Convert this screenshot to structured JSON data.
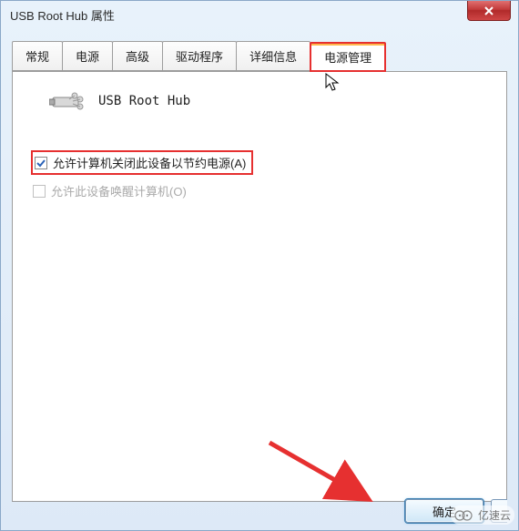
{
  "window": {
    "title": "USB Root Hub 属性"
  },
  "tabs": [
    {
      "label": "常规"
    },
    {
      "label": "电源"
    },
    {
      "label": "高级"
    },
    {
      "label": "驱动程序"
    },
    {
      "label": "详细信息"
    },
    {
      "label": "电源管理"
    }
  ],
  "device": {
    "name": "USB Root Hub"
  },
  "checkboxes": {
    "allow_shutdown": {
      "label": "允许计算机关闭此设备以节约电源(A)",
      "checked": true,
      "enabled": true
    },
    "allow_wake": {
      "label": "允许此设备唤醒计算机(O)",
      "checked": false,
      "enabled": false
    }
  },
  "buttons": {
    "ok": "确定"
  },
  "watermark": "亿速云",
  "highlight": {
    "active_tab_index": 5
  }
}
